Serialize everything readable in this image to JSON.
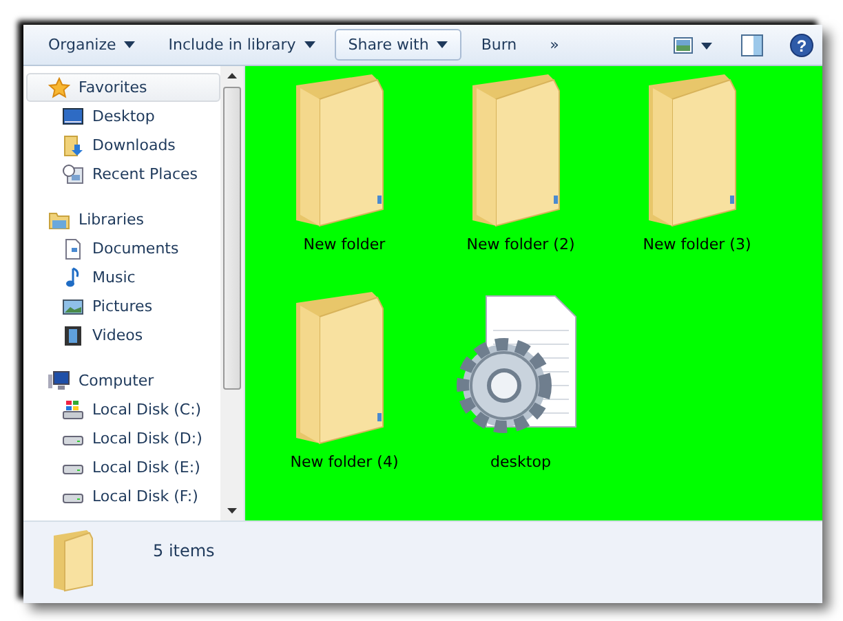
{
  "toolbar": {
    "items": [
      {
        "label": "Organize",
        "dropdown": true,
        "selected": false
      },
      {
        "label": "Include in library",
        "dropdown": true,
        "selected": false
      },
      {
        "label": "Share with",
        "dropdown": true,
        "selected": true
      },
      {
        "label": "Burn",
        "dropdown": false,
        "selected": false
      },
      {
        "label": "»",
        "dropdown": false,
        "selected": false
      }
    ],
    "help": "?"
  },
  "sidebar": {
    "groups": [
      {
        "label": "Favorites",
        "kind": "favorites",
        "selected": true,
        "children": [
          {
            "label": "Desktop",
            "kind": "desktop"
          },
          {
            "label": "Downloads",
            "kind": "downloads"
          },
          {
            "label": "Recent Places",
            "kind": "recent"
          }
        ]
      },
      {
        "label": "Libraries",
        "kind": "libraries",
        "selected": false,
        "children": [
          {
            "label": "Documents",
            "kind": "documents"
          },
          {
            "label": "Music",
            "kind": "music"
          },
          {
            "label": "Pictures",
            "kind": "pictures"
          },
          {
            "label": "Videos",
            "kind": "videos"
          }
        ]
      },
      {
        "label": "Computer",
        "kind": "computer",
        "selected": false,
        "children": [
          {
            "label": "Local Disk (C:)",
            "kind": "system-disk"
          },
          {
            "label": "Local Disk (D:)",
            "kind": "disk"
          },
          {
            "label": "Local Disk (E:)",
            "kind": "disk"
          },
          {
            "label": "Local Disk (F:)",
            "kind": "disk"
          }
        ]
      }
    ]
  },
  "files": [
    {
      "name": "New folder",
      "kind": "folder"
    },
    {
      "name": "New folder (2)",
      "kind": "folder"
    },
    {
      "name": "New folder (3)",
      "kind": "folder"
    },
    {
      "name": "New folder (4)",
      "kind": "folder"
    },
    {
      "name": "desktop",
      "kind": "settings-file"
    }
  ],
  "status_bar": {
    "count": "5 items"
  }
}
